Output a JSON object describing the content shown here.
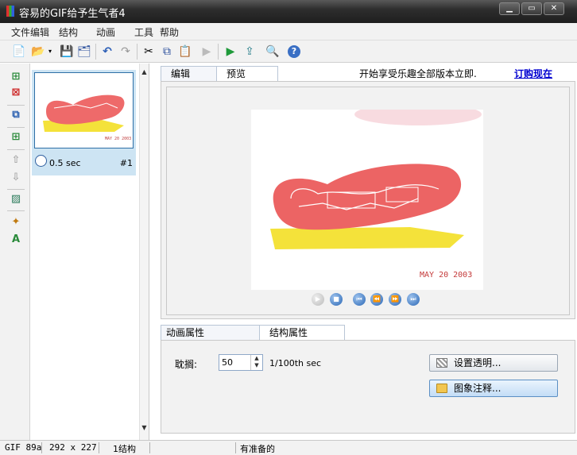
{
  "window": {
    "title": "容易的GIF给予生气者4",
    "minimize": "▁",
    "maximize": "▭",
    "close": "✕"
  },
  "menu": {
    "file_edit": "文件编辑",
    "structure": "结构",
    "animation": "动画",
    "tools": "工具",
    "help": "帮助"
  },
  "toolbar": {
    "new": "📄",
    "open": "📂",
    "save": "💾",
    "save_all": "🗂",
    "undo": "↶",
    "redo": "↷",
    "cut": "✂",
    "copy": "⧉",
    "paste": "📋",
    "play": "▶",
    "play_frame": "▶",
    "export": "⇪",
    "preview": "🔍",
    "help": "?"
  },
  "frame_list": {
    "frame_time": "0.5 sec",
    "frame_number": "#1"
  },
  "tabs": {
    "edit": "编辑",
    "preview": "预览"
  },
  "promo": {
    "text": "开始享受乐趣全部版本立即.",
    "buy_link": "订购现在"
  },
  "image": {
    "date_stamp": "MAY 20 2003"
  },
  "props_tabs": {
    "animation_props": "动画属性",
    "structure_props": "结构属性"
  },
  "props": {
    "delay_label": "耽搁:",
    "delay_value": "50",
    "delay_unit": "1/100th sec",
    "set_transparent": "设置透明...",
    "image_comment": "图象注释..."
  },
  "status": {
    "format": "GIF 89a",
    "dimensions": "292 x 227",
    "frames": "1结构",
    "state": "有准备的"
  }
}
